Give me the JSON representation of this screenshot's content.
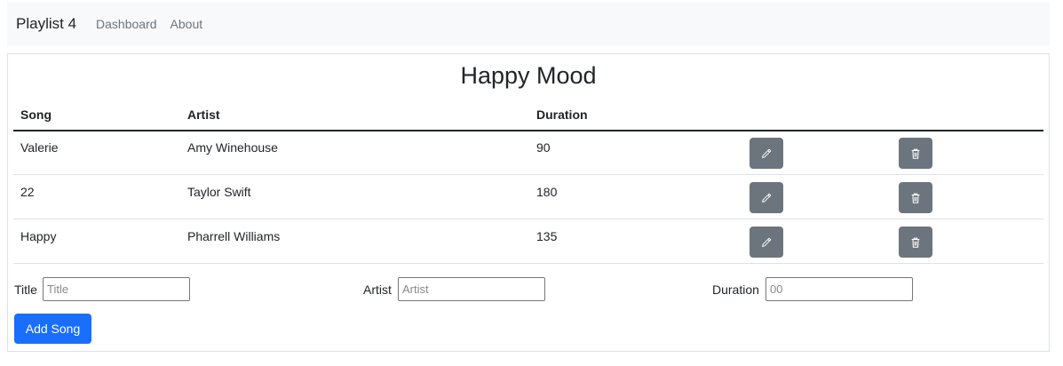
{
  "nav": {
    "brand": "Playlist 4",
    "links": [
      "Dashboard",
      "About"
    ]
  },
  "playlist": {
    "title": "Happy Mood",
    "headers": {
      "song": "Song",
      "artist": "Artist",
      "duration": "Duration"
    },
    "songs": [
      {
        "song": "Valerie",
        "artist": "Amy Winehouse",
        "duration": "90"
      },
      {
        "song": "22",
        "artist": "Taylor Swift",
        "duration": "180"
      },
      {
        "song": "Happy",
        "artist": "Pharrell Williams",
        "duration": "135"
      }
    ]
  },
  "form": {
    "title_label": "Title",
    "title_placeholder": "Title",
    "artist_label": "Artist",
    "artist_placeholder": "Artist",
    "duration_label": "Duration",
    "duration_placeholder": "00",
    "add_button": "Add Song"
  },
  "colors": {
    "action_button": "#6c757d",
    "primary": "#1a6efc"
  },
  "icons": {
    "edit": "pencil-icon",
    "delete": "trash-icon"
  }
}
